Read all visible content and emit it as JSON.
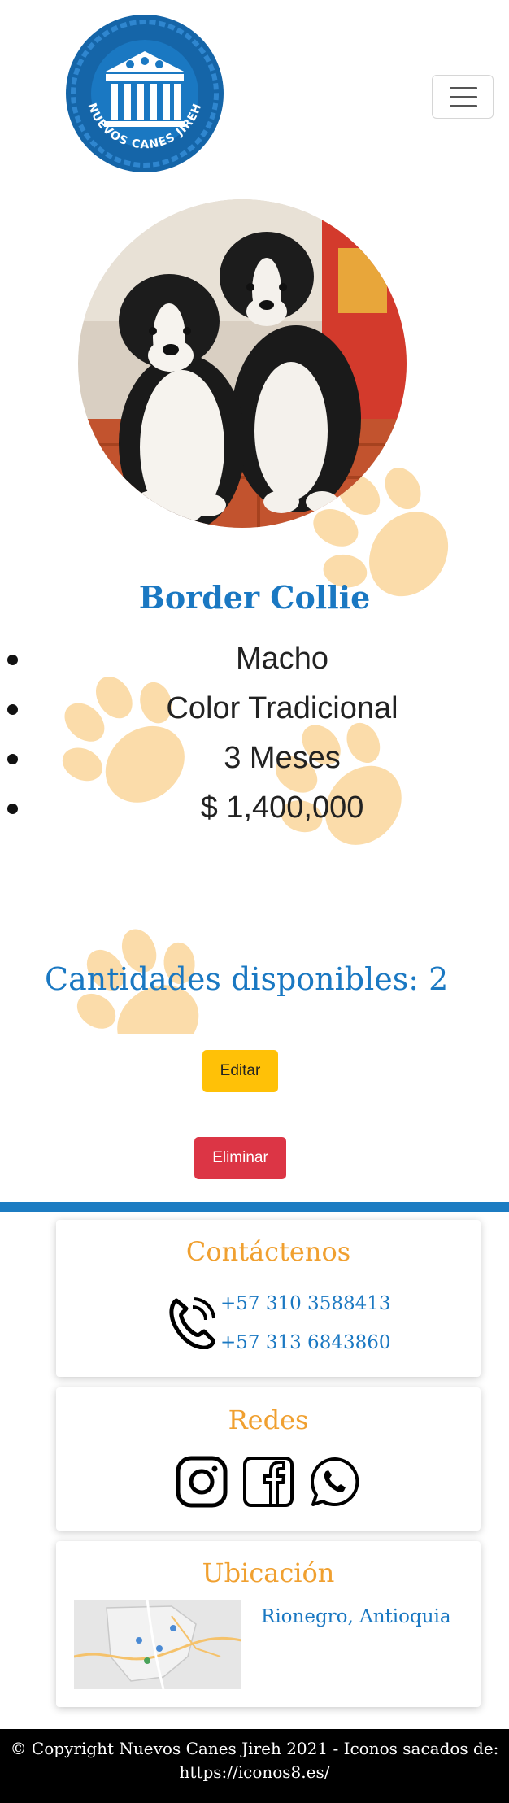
{
  "header": {
    "logo_text": "NUEVOS CANES JIREH",
    "menu_icon": "hamburger-icon"
  },
  "product": {
    "photo_alt": "Border Collie",
    "breed": "Border Collie",
    "details": [
      "Macho",
      "Color Tradicional",
      "3 Meses",
      "$ 1,400,000"
    ],
    "quantity_text": "Cantidades disponibles: 2",
    "edit_label": "Editar",
    "delete_label": "Eliminar"
  },
  "contact": {
    "title": "Contáctenos",
    "icon": "phone-icon",
    "phones": [
      "+57 310 3588413",
      "+57 313 6843860"
    ]
  },
  "social": {
    "title": "Redes",
    "icons": [
      "instagram-icon",
      "facebook-icon",
      "whatsapp-icon"
    ]
  },
  "location": {
    "title": "Ubicación",
    "place": "Rionegro, Antioquia",
    "map_icon": "map-thumbnail"
  },
  "footer": {
    "line1": "© Copyright Nuevos Canes Jireh 2021 - Iconos sacados de:",
    "line2": "https://iconos8.es/"
  },
  "colors": {
    "primary_blue": "#1a78c2",
    "accent_orange": "#f0a030",
    "paw": "#fbdcaa",
    "edit_yellow": "#ffc107",
    "delete_red": "#dc3545"
  }
}
